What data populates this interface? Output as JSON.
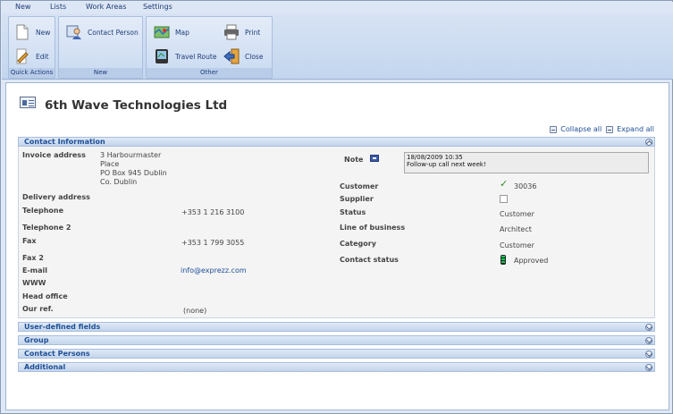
{
  "menubar": {
    "items": [
      "New",
      "Lists",
      "Work Areas",
      "Settings"
    ]
  },
  "ribbon": {
    "quick_actions": {
      "label": "Quick Actions",
      "new_label": "New",
      "edit_label": "Edit"
    },
    "new_group": {
      "label": "New",
      "contact_person_label": "Contact Person"
    },
    "other_group": {
      "label": "Other",
      "map_label": "Map",
      "print_label": "Print",
      "travel_route_label": "Travel Route",
      "close_label": "Close"
    }
  },
  "page": {
    "title": "6th Wave Technologies Ltd",
    "collapse_all": "Collapse all",
    "expand_all": "Expand all"
  },
  "sections": {
    "contact_information": "Contact Information",
    "user_defined_fields": "User-defined fields",
    "group": "Group",
    "contact_persons": "Contact Persons",
    "additional": "Additional"
  },
  "contact_info": {
    "left": {
      "invoice_address_label": "Invoice address",
      "invoice_address_lines": [
        "3 Harbourmaster",
        "Place",
        "PO Box 945 Dublin",
        "Co. Dublin"
      ],
      "delivery_address_label": "Delivery address",
      "telephone_label": "Telephone",
      "telephone_value": "+353 1 216 3100",
      "telephone2_label": "Telephone 2",
      "fax_label": "Fax",
      "fax_value": "+353 1 799 3055",
      "fax2_label": "Fax 2",
      "email_label": "E-mail",
      "email_value": "info@exprezz.com",
      "www_label": "WWW",
      "head_office_label": "Head office",
      "our_ref_label": "Our ref.",
      "our_ref_value": "(none)"
    },
    "right": {
      "note_label": "Note",
      "note_date": "18/08/2009 10:35",
      "note_text": "Follow-up call next week!",
      "customer_label": "Customer",
      "customer_value": "30036",
      "supplier_label": "Supplier",
      "status_label": "Status",
      "status_value": "Customer",
      "line_of_business_label": "Line of business",
      "line_of_business_value": "Architect",
      "category_label": "Category",
      "category_value": "Customer",
      "contact_status_label": "Contact status",
      "contact_status_value": "Approved"
    }
  },
  "colors": {
    "accent": "#1e4f96",
    "ribbon": "#c3d6ee",
    "check_green": "#2c8a1f"
  }
}
